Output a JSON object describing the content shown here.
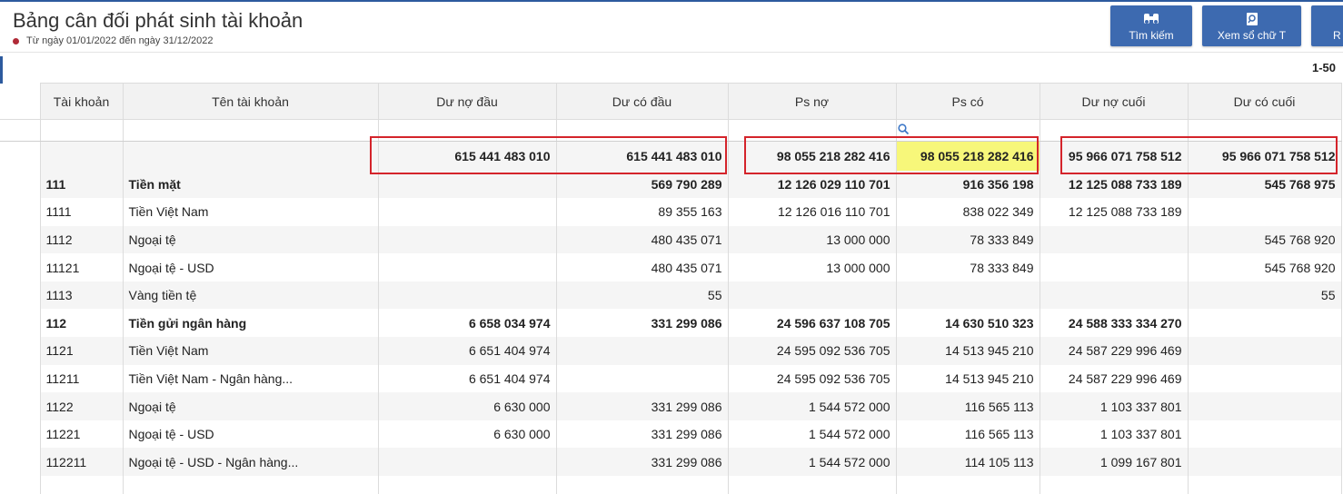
{
  "header": {
    "title": "Bảng cân đối phát sinh tài khoản",
    "subtitle": "Từ ngày 01/01/2022 đến ngày 31/12/2022"
  },
  "toolbar": {
    "search_label": "Tìm kiếm",
    "ledger_label": "Xem sổ chữ T",
    "third_label": "R",
    "button_color": "#3d6ab0"
  },
  "pager": {
    "range": "1-50"
  },
  "table": {
    "columns": [
      "Tài khoản",
      "Tên tài khoản",
      "Dư nợ đầu",
      "Dư có đầu",
      "Ps nợ",
      "Ps có",
      "Dư nợ cuối",
      "Dư có cuối"
    ],
    "totals": [
      "615 441 483 010",
      "615 441 483 010",
      "98 055 218 282 416",
      "98 055 218 282 416",
      "95 966 071 758 512",
      "95 966 071 758 512"
    ],
    "rows": [
      {
        "code": "111",
        "name": "Tiền mặt",
        "v": [
          "",
          "569 790 289",
          "12 126 029 110 701",
          "916 356 198",
          "12 125 088 733 189",
          "545 768 975"
        ],
        "bold": true
      },
      {
        "code": "1111",
        "name": "Tiền Việt Nam",
        "v": [
          "",
          "89 355 163",
          "12 126 016 110 701",
          "838 022 349",
          "12 125 088 733 189",
          ""
        ],
        "bold": false
      },
      {
        "code": "1112",
        "name": "Ngoại tệ",
        "v": [
          "",
          "480 435 071",
          "13 000 000",
          "78 333 849",
          "",
          "545 768 920"
        ],
        "bold": false
      },
      {
        "code": "11121",
        "name": "Ngoại tệ - USD",
        "v": [
          "",
          "480 435 071",
          "13 000 000",
          "78 333 849",
          "",
          "545 768 920"
        ],
        "bold": false
      },
      {
        "code": "1113",
        "name": "Vàng tiền tệ",
        "v": [
          "",
          "55",
          "",
          "",
          "",
          "55"
        ],
        "bold": false
      },
      {
        "code": "112",
        "name": "Tiền gửi ngân hàng",
        "v": [
          "6 658 034 974",
          "331 299 086",
          "24 596 637 108 705",
          "14 630 510 323",
          "24 588 333 334 270",
          ""
        ],
        "bold": true
      },
      {
        "code": "1121",
        "name": "Tiền Việt Nam",
        "v": [
          "6 651 404 974",
          "",
          "24 595 092 536 705",
          "14 513 945 210",
          "24 587 229 996 469",
          ""
        ],
        "bold": false
      },
      {
        "code": "11211",
        "name": "Tiền Việt Nam - Ngân hàng...",
        "v": [
          "6 651 404 974",
          "",
          "24 595 092 536 705",
          "14 513 945 210",
          "24 587 229 996 469",
          ""
        ],
        "bold": false
      },
      {
        "code": "1122",
        "name": "Ngoại tệ",
        "v": [
          "6 630 000",
          "331 299 086",
          "1 544 572 000",
          "116 565 113",
          "1 103 337 801",
          ""
        ],
        "bold": false
      },
      {
        "code": "11221",
        "name": "Ngoại tệ - USD",
        "v": [
          "6 630 000",
          "331 299 086",
          "1 544 572 000",
          "116 565 113",
          "1 103 337 801",
          ""
        ],
        "bold": false
      },
      {
        "code": "112211",
        "name": "Ngoại tệ - USD - Ngân hàng...",
        "v": [
          "",
          "331 299 086",
          "1 544 572 000",
          "114 105 113",
          "1 099 167 801",
          ""
        ],
        "bold": false
      },
      {
        "code": "",
        "name": "",
        "v": [
          "",
          "",
          "",
          "",
          "",
          ""
        ],
        "bold": false
      }
    ]
  },
  "colors": {
    "accent": "#2d5a9e",
    "highlight": "#f7f77a",
    "annotation_box": "#d4242b"
  },
  "icons": {
    "search": "binoculars-icon",
    "ledger": "document-search-icon",
    "filter": "magnifier-icon"
  }
}
